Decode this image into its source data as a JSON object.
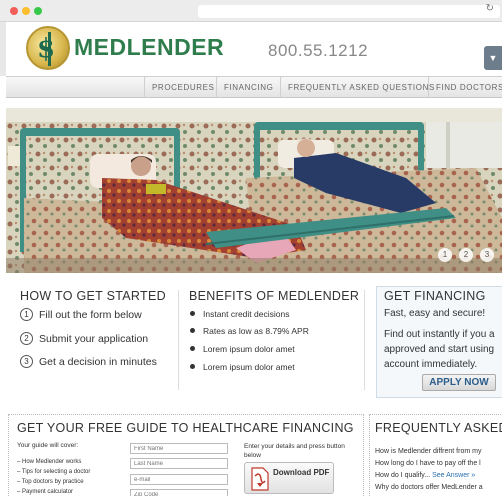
{
  "header": {
    "brand": "MEDLENDER",
    "phone": "800.55.1212"
  },
  "nav": {
    "items": [
      "PROCEDURES",
      "FINANCING",
      "FREQUENTLY ASKED QUESTIONS",
      "FIND DOCTORS"
    ]
  },
  "hero": {
    "pager": [
      "1",
      "2",
      "3"
    ]
  },
  "get_started": {
    "title": "HOW TO GET STARTED",
    "steps": [
      {
        "num": "1",
        "label": "Fill out the form below"
      },
      {
        "num": "2",
        "label": "Submit your application"
      },
      {
        "num": "3",
        "label": "Get a decision in minutes"
      }
    ]
  },
  "benefits": {
    "title": "BENEFITS OF MEDLENDER",
    "items": [
      "Instant credit decisions",
      "Rates as low as 8.79% APR",
      "Lorem ipsum dolor amet",
      "Lorem ipsum dolor amet"
    ]
  },
  "financing": {
    "title": "GET FINANCING",
    "tagline": "Fast, easy and secure!",
    "body_lines": [
      "Find out instantly if you a",
      "approved and start using",
      "account immediately."
    ],
    "apply_label": "APPLY NOW"
  },
  "guide": {
    "title": "GET YOUR FREE GUIDE TO HEALTHCARE FINANCING",
    "intro": "Your guide will cover:",
    "tips": [
      "– How Medlender works",
      "– Tips for selecting a doctor",
      "– Top doctors by practice",
      "– Payment calculator"
    ],
    "fields": [
      {
        "placeholder": "First Name"
      },
      {
        "placeholder": "Last Name"
      },
      {
        "placeholder": "e-mail"
      },
      {
        "placeholder": "Zip Code"
      }
    ],
    "instructions": "Enter your details and press button below",
    "download_label": "Download PDF"
  },
  "faq": {
    "title": "FREQUENTLY ASKED",
    "questions": [
      {
        "text": "How is Medlender diffrent from my",
        "link": ""
      },
      {
        "text": "How long do I have to pay off the l",
        "link": ""
      },
      {
        "text": "How do I qualify...",
        "link": "See Answer »"
      },
      {
        "text": "Why do doctors offer MedLender a",
        "link": ""
      }
    ]
  },
  "colors": {
    "brand_green": "#2f7c4c",
    "link_blue": "#2a6fb0",
    "button_text": "#2a5d8a"
  }
}
